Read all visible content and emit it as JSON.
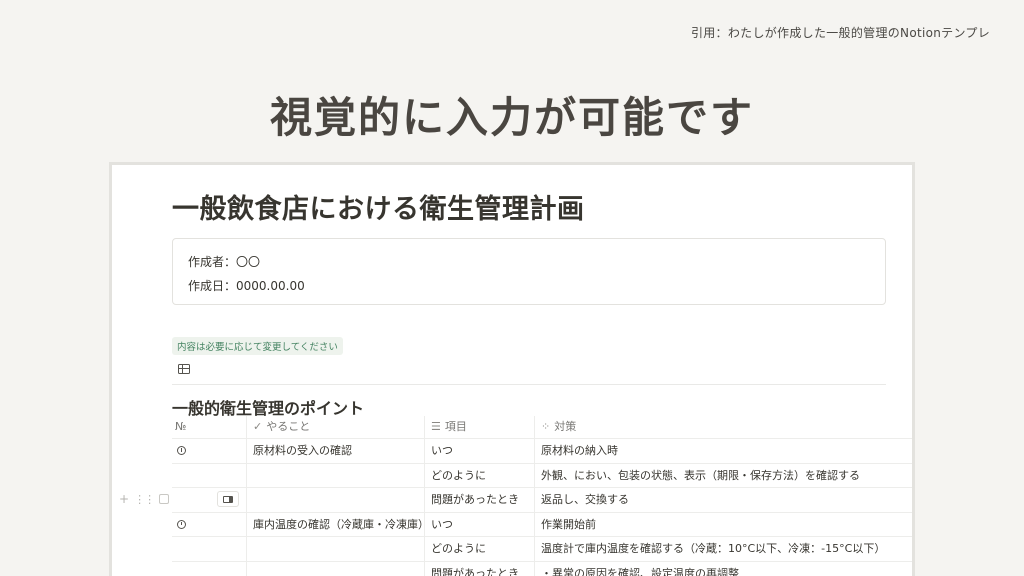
{
  "slide": {
    "citation": "引用：わたしが作成した一般的管理のNotionテンプレ",
    "title": "視覚的に入力が可能です"
  },
  "page": {
    "title": "一般飲食店における衛生管理計画",
    "callout": {
      "author": "作成者：〇〇",
      "date": "作成日：0000.00.00"
    },
    "note_badge": "内容は必要に応じて変更してください",
    "section_heading": "一般的衛生管理のポイント"
  },
  "table": {
    "columns": [
      {
        "label": "№",
        "icon": "number-icon"
      },
      {
        "label": "やること",
        "icon": "check-icon"
      },
      {
        "label": "項目",
        "icon": "list-icon"
      },
      {
        "label": "対策",
        "icon": "loading-icon"
      }
    ],
    "rows": [
      [
        "",
        "原材料の受入の確認",
        "いつ",
        "原材料の納入時"
      ],
      [
        "",
        "",
        "どのように",
        "外観、におい、包装の状態、表示（期限・保存方法）を確認する"
      ],
      [
        "",
        "",
        "問題があったとき",
        "返品し、交換する"
      ],
      [
        "",
        "庫内温度の確認（冷蔵庫・冷凍庫）",
        "いつ",
        "作業開始前"
      ],
      [
        "",
        "",
        "どのように",
        "温度計で庫内温度を確認する（冷蔵：10°C以下、冷凍：-15°C以下）"
      ],
      [
        "",
        "",
        "問題があったとき",
        "・異常の原因を確認、設定温度の再調整"
      ]
    ]
  },
  "colors": {
    "background": "#f5f4f1",
    "note_text": "#448361",
    "note_bg": "#eef3ed"
  }
}
